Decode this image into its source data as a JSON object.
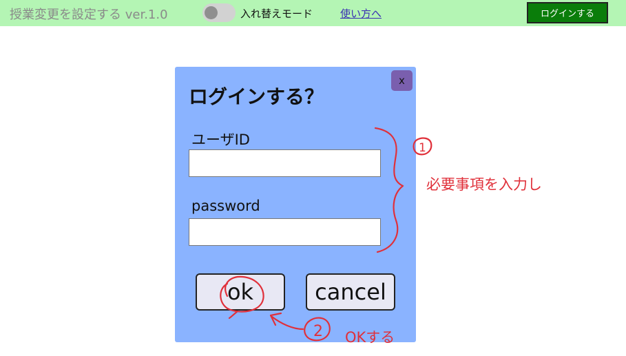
{
  "header": {
    "app_title": "授業変更を設定する ver.1.0",
    "toggle_label": "入れ替えモード",
    "toggle_on": false,
    "help_link": "使い方へ",
    "login_button": "ログインする"
  },
  "modal": {
    "close_label": "x",
    "title": "ログインする？",
    "user_id_label": "ユーザID",
    "user_id_value": "",
    "password_label": "password",
    "password_value": "",
    "ok_label": "ok",
    "cancel_label": "cancel"
  },
  "annotations": {
    "step1_number": "1",
    "step1_text": "必要事項を入力し",
    "step2_number": "2",
    "step2_text": "OKする",
    "color": "#e0303a"
  },
  "colors": {
    "header_bg": "#b4f5b4",
    "modal_bg": "#8ab3ff",
    "login_button_bg": "#0a7d0a",
    "close_button_bg": "#7a5fae"
  }
}
